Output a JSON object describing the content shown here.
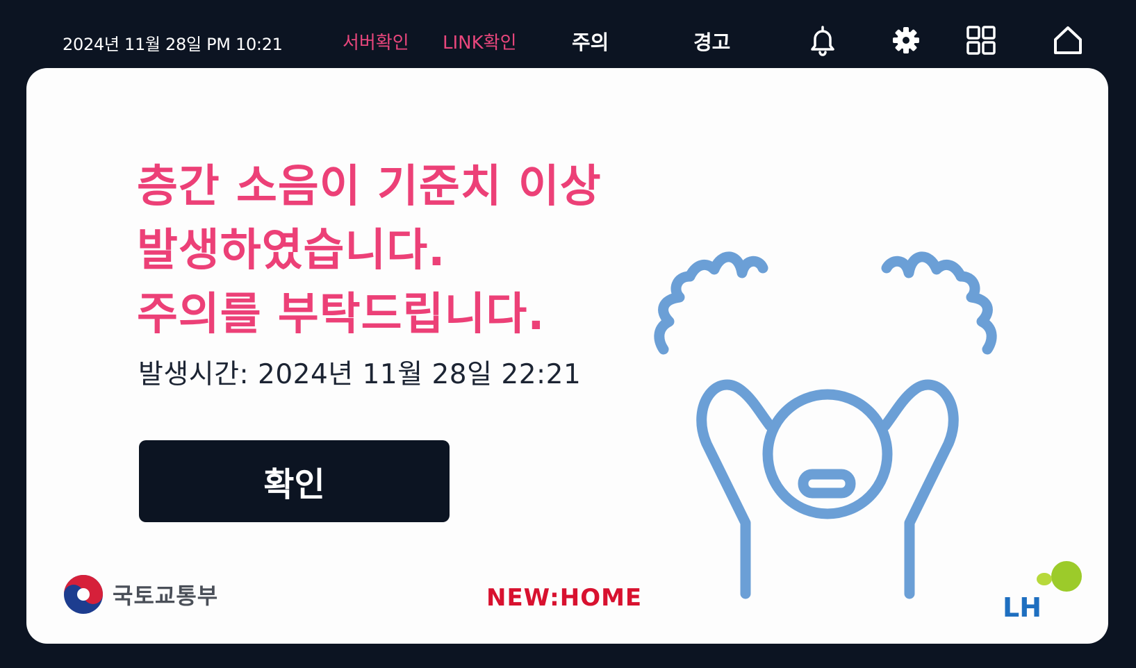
{
  "topbar": {
    "datetime": "2024년 11월 28일 PM 10:21",
    "server_check": "서버확인",
    "link_check": "LINK확인",
    "tab_caution": "주의",
    "tab_warning": "경고",
    "icons": [
      "bell-icon",
      "gear-icon",
      "grid-icon",
      "home-icon"
    ]
  },
  "alert": {
    "line1": "층간 소음이 기준치 이상",
    "line2": "발생하였습니다.",
    "line3": "주의를 부탁드립니다.",
    "occurred_time": "발생시간: 2024년 11월 28일 22:21",
    "confirm_label": "확인"
  },
  "footer": {
    "ministry": "국토교통부",
    "brand": "NEW:HOME",
    "company": "LH"
  },
  "colors": {
    "background": "#0c1422",
    "card": "#fdfdfd",
    "accent_pink": "#ec4077",
    "illustration_blue": "#6b9fd6",
    "brand_red": "#d8112f",
    "lh_blue": "#1e6fc0",
    "lh_green": "#9ccb2a"
  }
}
